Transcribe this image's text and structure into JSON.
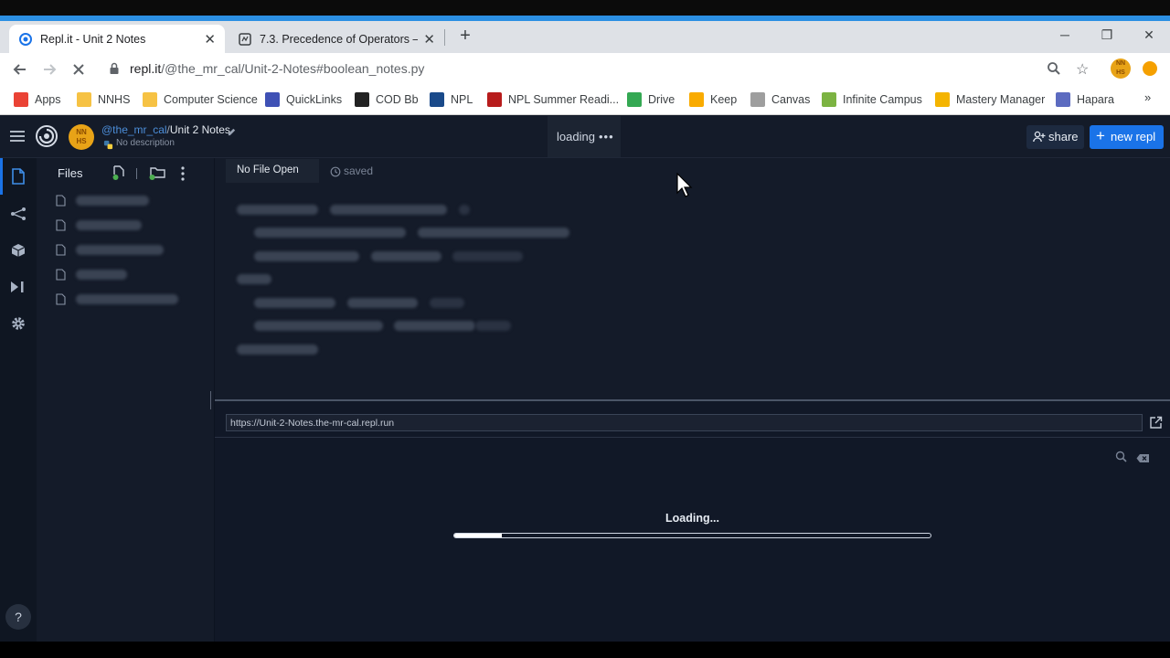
{
  "browser": {
    "tabs": [
      {
        "title": "Repl.it - Unit 2 Notes",
        "active": true
      },
      {
        "title": "7.3. Precedence of Operators — ",
        "active": false
      }
    ],
    "new_tab": "+",
    "url_host": "repl.it",
    "url_path": "/@the_mr_cal/Unit-2-Notes#boolean_notes.py",
    "bookmarks": [
      {
        "label": "Apps",
        "icon": "apps-grid-icon",
        "color": "#ea4335"
      },
      {
        "label": "NNHS",
        "icon": "folder-icon",
        "color": "#f6c244"
      },
      {
        "label": "Computer Science",
        "icon": "folder-icon",
        "color": "#f6c244"
      },
      {
        "label": "QuickLinks",
        "icon": "quicklinks-icon",
        "color": "#3f51b5"
      },
      {
        "label": "COD Bb",
        "icon": "blackboard-icon",
        "color": "#222222"
      },
      {
        "label": "NPL",
        "icon": "npl-icon",
        "color": "#1a4a8a"
      },
      {
        "label": "NPL Summer Readi...",
        "icon": "npl-summer-icon",
        "color": "#b71c1c"
      },
      {
        "label": "Drive",
        "icon": "drive-icon",
        "color": "#34a853"
      },
      {
        "label": "Keep",
        "icon": "keep-icon",
        "color": "#f9ab00"
      },
      {
        "label": "Canvas",
        "icon": "canvas-icon",
        "color": "#9e9e9e"
      },
      {
        "label": "Infinite Campus",
        "icon": "infinite-campus-icon",
        "color": "#7cb342"
      },
      {
        "label": "Mastery Manager",
        "icon": "mastery-manager-icon",
        "color": "#f4b400"
      },
      {
        "label": "Hapara",
        "icon": "hapara-icon",
        "color": "#5c6bc0"
      }
    ],
    "more": "»"
  },
  "repl": {
    "owner": "@the_mr_cal",
    "separator": "/",
    "name": "Unit 2 Notes",
    "description": "No description",
    "avatar_text": "NN\nHS",
    "status": "loading",
    "share_label": "share",
    "new_repl_label": "new repl",
    "accent": "#1a73e8"
  },
  "files": {
    "header": "Files",
    "count": 5
  },
  "editor": {
    "tab_label": "No File Open",
    "saved_label": "saved"
  },
  "webview": {
    "url": "https://Unit-2-Notes.the-mr-cal.repl.run",
    "loading_text": "Loading...",
    "progress": 0.1
  },
  "help_label": "?"
}
